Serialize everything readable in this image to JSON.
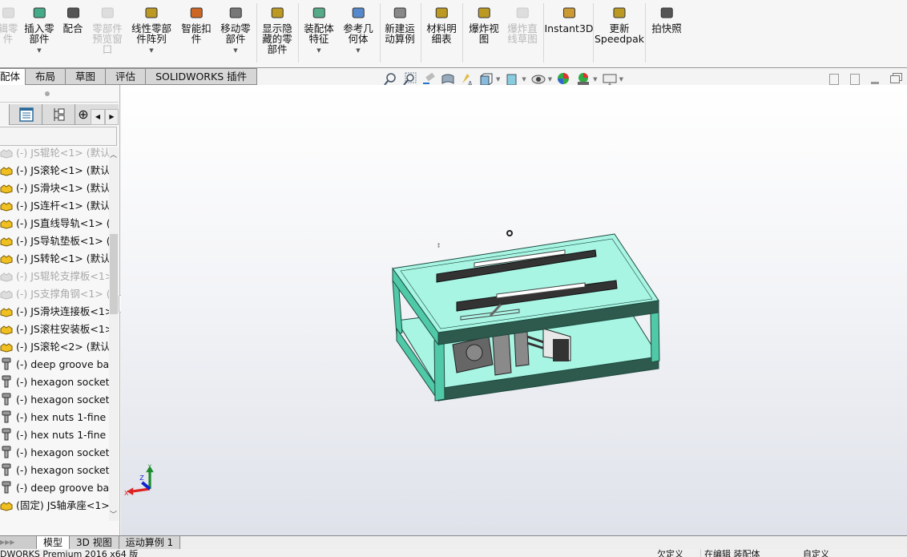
{
  "toolbar": {
    "buttons": [
      {
        "label": "辑零\n件",
        "disabled": true
      },
      {
        "label": "插入零\n部件",
        "disabled": false
      },
      {
        "label": "配合",
        "disabled": false
      },
      {
        "label": "零部件\n预览窗\n口",
        "disabled": true
      },
      {
        "label": "线性零部\n件阵列",
        "disabled": false
      },
      {
        "label": "智能扣\n件",
        "disabled": false
      },
      {
        "label": "移动零\n部件",
        "disabled": false
      },
      {
        "label": "显示隐\n藏的零\n部件",
        "disabled": false
      },
      {
        "label": "装配体\n特征",
        "disabled": false
      },
      {
        "label": "参考几\n何体",
        "disabled": false
      },
      {
        "label": "新建运\n动算例",
        "disabled": false
      },
      {
        "label": "材料明\n细表",
        "disabled": false
      },
      {
        "label": "爆炸视\n图",
        "disabled": false
      },
      {
        "label": "爆炸直\n线草图",
        "disabled": true
      },
      {
        "label": "Instant3D",
        "disabled": false
      },
      {
        "label": "更新\nSpeedpak",
        "disabled": false
      },
      {
        "label": "拍快照",
        "disabled": false
      }
    ]
  },
  "tabs": [
    "配体",
    "布局",
    "草图",
    "评估",
    "SOLIDWORKS 插件"
  ],
  "tree": {
    "items": [
      {
        "label": "(-) JS辊轮<1> (默认)",
        "type": "part",
        "suppressed": true
      },
      {
        "label": "(-) JS滚轮<1> (默认<",
        "type": "part",
        "suppressed": false
      },
      {
        "label": "(-) JS滑块<1> (默认<",
        "type": "part",
        "suppressed": false
      },
      {
        "label": "(-) JS连杆<1> (默认<",
        "type": "part",
        "suppressed": false
      },
      {
        "label": "(-) JS直线导轨<1> (默",
        "type": "part",
        "suppressed": false
      },
      {
        "label": "(-) JS导轨垫板<1> (默",
        "type": "part",
        "suppressed": false
      },
      {
        "label": "(-) JS转轮<1> (默认<",
        "type": "part",
        "suppressed": false
      },
      {
        "label": "(-) JS辊轮支撑板<1>",
        "type": "part",
        "suppressed": true
      },
      {
        "label": "(-) JS支撑角钢<1> (默",
        "type": "part",
        "suppressed": true
      },
      {
        "label": "(-) JS滑块连接板<1>",
        "type": "part",
        "suppressed": false
      },
      {
        "label": "(-) JS滚柱安装板<1>",
        "type": "part",
        "suppressed": false
      },
      {
        "label": "(-) JS滚轮<2> (默认<",
        "type": "part",
        "suppressed": false
      },
      {
        "label": "(-) deep groove ba",
        "type": "fastener",
        "suppressed": false
      },
      {
        "label": "(-) hexagon socket",
        "type": "fastener",
        "suppressed": false
      },
      {
        "label": "(-) hexagon socket",
        "type": "fastener",
        "suppressed": false
      },
      {
        "label": "(-) hex nuts 1-fine p",
        "type": "fastener",
        "suppressed": false
      },
      {
        "label": "(-) hex nuts 1-fine p",
        "type": "fastener",
        "suppressed": false
      },
      {
        "label": "(-) hexagon socket",
        "type": "fastener",
        "suppressed": false
      },
      {
        "label": "(-) hexagon socket",
        "type": "fastener",
        "suppressed": false
      },
      {
        "label": "(-) deep groove ba",
        "type": "fastener",
        "suppressed": false
      },
      {
        "label": "(固定) JS轴承座<1>",
        "type": "part",
        "suppressed": false
      }
    ]
  },
  "triad": {
    "x": "X",
    "y": "Y",
    "z": "Z"
  },
  "bottom_tabs": [
    "模型",
    "3D 视图",
    "运动算例 1"
  ],
  "status": {
    "app": "DWORKS Premium 2016 x64 版",
    "definition": "欠定义",
    "editing": "在编辑 装配体",
    "units": "自定义"
  },
  "colors": {
    "frame": "#4fc9a8",
    "plate": "#a8f5e4",
    "part_icon": "#f0c020"
  }
}
